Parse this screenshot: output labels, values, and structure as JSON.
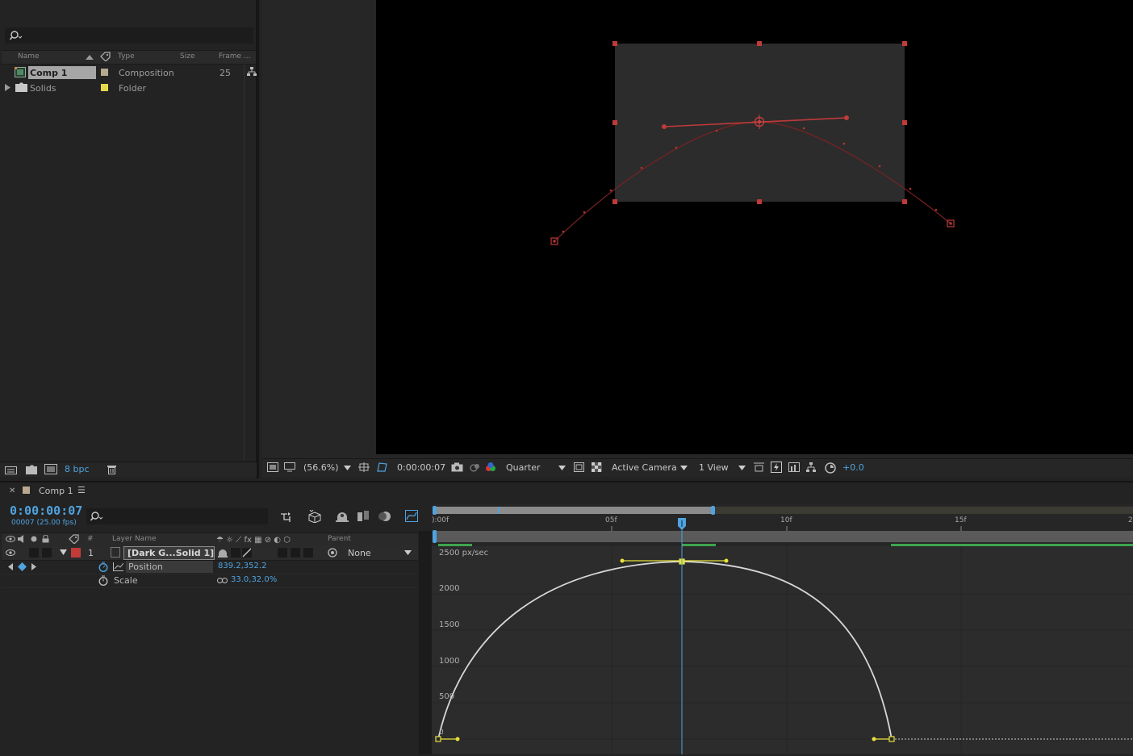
{
  "project": {
    "columns": {
      "name": "Name",
      "type": "Type",
      "size": "Size",
      "frame": "Frame ..."
    },
    "items": [
      {
        "name": "Comp 1",
        "type": "Composition",
        "frame": "25",
        "label_color": "#b7a98f"
      },
      {
        "name": "Solids",
        "type": "Folder",
        "frame": "",
        "label_color": "#e5d84c"
      }
    ],
    "bpc": "8 bpc"
  },
  "viewer": {
    "zoom": "(56.6%)",
    "timecode": "0:00:00:07",
    "resolution": "Quarter",
    "camera": "Active Camera",
    "views": "1 View",
    "exposure": "+0.0"
  },
  "timeline": {
    "tab_label": "Comp 1",
    "timecode": "0:00:00:07",
    "frame_info": "00007 (25.00 fps)",
    "header": {
      "layer_name": "Layer Name",
      "parent": "Parent",
      "num": "#"
    },
    "layer": {
      "number": "1",
      "name": "[Dark G...Solid 1]",
      "parent": "None",
      "label_color": "#c13b3b"
    },
    "properties": [
      {
        "name": "Position",
        "value": "839.2,352.2"
      },
      {
        "name": "Scale",
        "value": "33.0,32.0%"
      }
    ],
    "ruler": [
      "):00f",
      "05f",
      "10f",
      "15f",
      "2"
    ],
    "graph": {
      "unit_label": "2500 px/sec",
      "y_labels": [
        "2000",
        "1500",
        "1000",
        "500",
        "0"
      ]
    }
  },
  "colors": {
    "accent_blue": "#4fa3e0",
    "keyframe_yellow": "#e8e23a",
    "motion_path_red": "#c03a3a"
  }
}
